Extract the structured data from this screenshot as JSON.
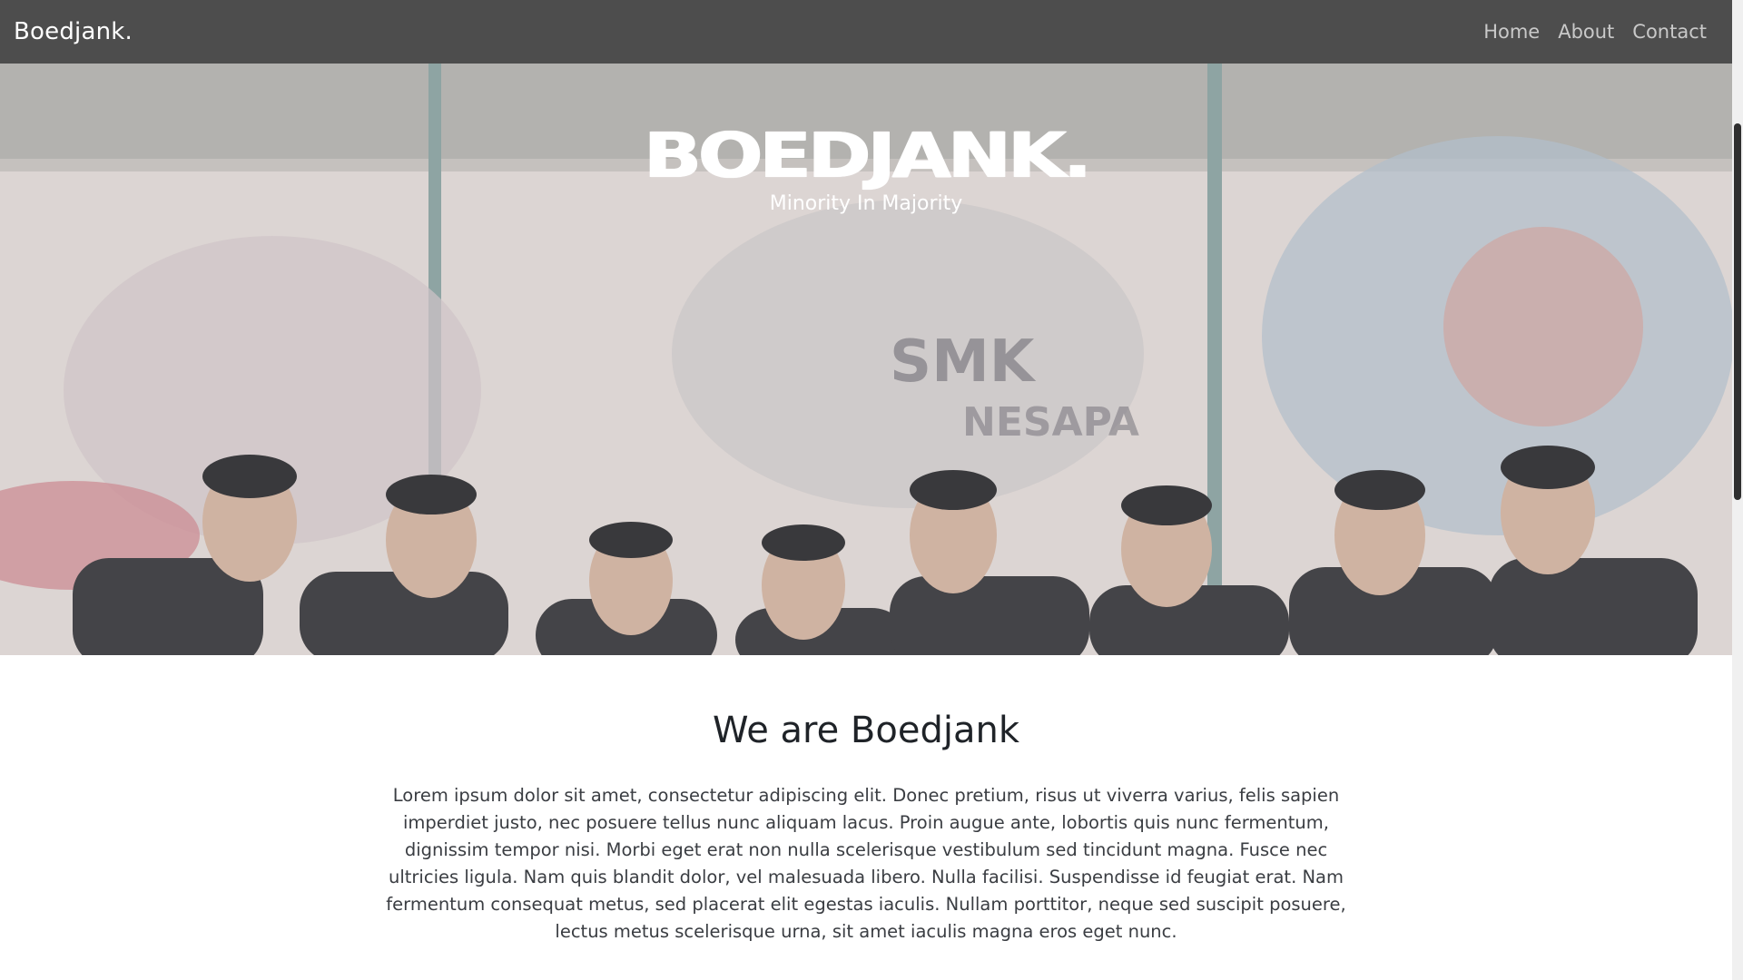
{
  "navbar": {
    "brand": "Boedjank.",
    "links": [
      "Home",
      "About",
      "Contact"
    ]
  },
  "hero": {
    "title": "BOEDJANK.",
    "subtitle": "Minority In Majority",
    "image": "group-photo-in-front-of-graffiti-wall"
  },
  "about": {
    "heading": "We are Boedjank",
    "body": "Lorem ipsum dolor sit amet, consectetur adipiscing elit. Donec pretium, risus ut viverra varius, felis sapien imperdiet justo, nec posuere tellus nunc aliquam lacus. Proin augue ante, lobortis quis nunc fermentum, dignissim tempor nisi. Morbi eget erat non nulla scelerisque vestibulum sed tincidunt magna. Fusce nec ultricies ligula. Nam quis blandit dolor, vel malesuada libero. Nulla facilisi. Suspendisse id feugiat erat. Nam fermentum consequat metus, sed placerat elit egestas iaculis. Nullam porttitor, neque sed suscipit posuere, lectus metus scelerisque urna, sit amet iaculis magna eros eget nunc."
  },
  "colors": {
    "navbar_bg": "#4d4d4d",
    "brand_text": "#ffffff",
    "nav_link_text": "#c9c9c9",
    "heading_text": "#1f2328",
    "body_text": "#3a3d42"
  }
}
